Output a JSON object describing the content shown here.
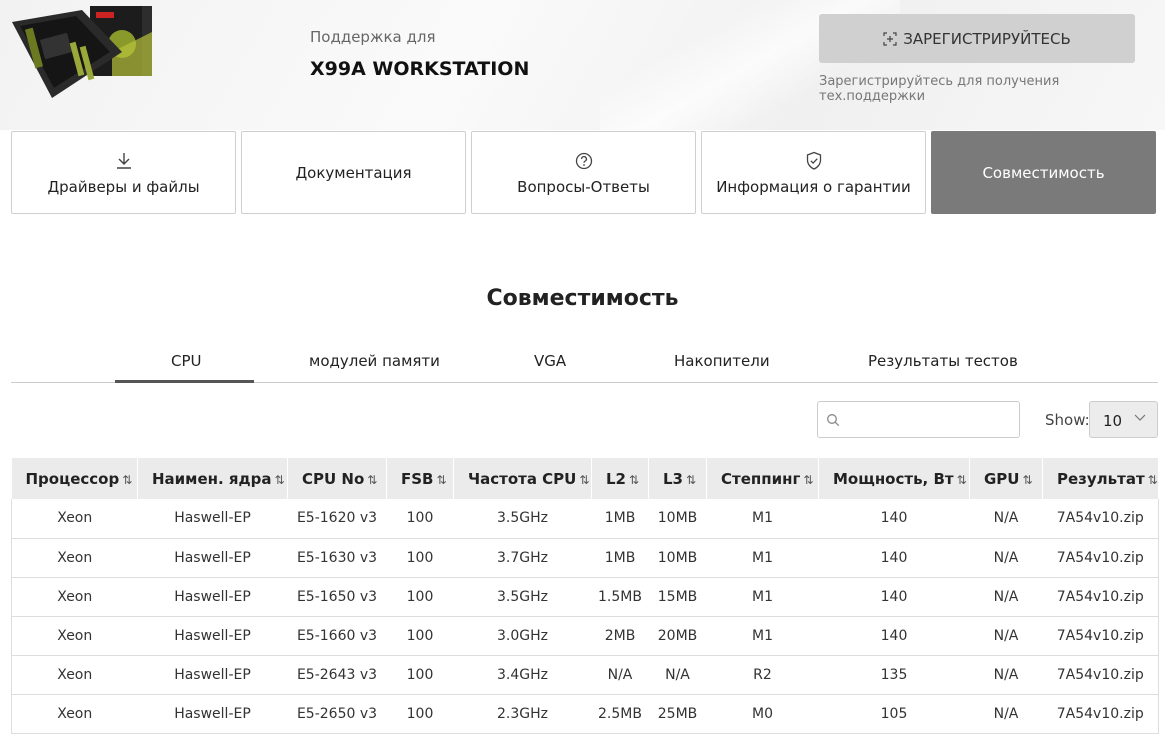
{
  "header": {
    "support_for": "Поддержка для",
    "model": "X99A WORKSTATION",
    "register_button": "ЗАРЕГИСТРИРУЙТЕСЬ",
    "register_note": "Зарегистрируйтесь для получения тех.поддержки"
  },
  "nav_tabs": [
    {
      "label": "Драйверы и файлы",
      "icon": "download-icon"
    },
    {
      "label": "Документация",
      "icon": ""
    },
    {
      "label": "Вопросы-Ответы",
      "icon": "question-icon"
    },
    {
      "label": "Информация о гарантии",
      "icon": "shield-check-icon"
    },
    {
      "label": "Совместимость",
      "icon": "",
      "active": true
    }
  ],
  "section": {
    "title": "Совместимость",
    "subtabs": [
      "CPU",
      "модулей памяти",
      "VGA",
      "Накопители",
      "Результаты тестов"
    ],
    "active_subtab": "CPU"
  },
  "controls": {
    "search_value": "",
    "show_label": "Show:",
    "show_value": "10"
  },
  "table": {
    "columns": [
      "Процессор",
      "Наимен. ядра",
      "CPU No",
      "FSB",
      "Частота CPU",
      "L2",
      "L3",
      "Степпинг",
      "Мощность, Вт",
      "GPU",
      "Результат"
    ],
    "sort_glyph": "⇅",
    "rows": [
      [
        "Xeon",
        "Haswell-EP",
        "E5-1620 v3",
        "100",
        "3.5GHz",
        "1MB",
        "10MB",
        "M1",
        "140",
        "N/A",
        "7A54v10.zip"
      ],
      [
        "Xeon",
        "Haswell-EP",
        "E5-1630 v3",
        "100",
        "3.7GHz",
        "1MB",
        "10MB",
        "M1",
        "140",
        "N/A",
        "7A54v10.zip"
      ],
      [
        "Xeon",
        "Haswell-EP",
        "E5-1650 v3",
        "100",
        "3.5GHz",
        "1.5MB",
        "15MB",
        "M1",
        "140",
        "N/A",
        "7A54v10.zip"
      ],
      [
        "Xeon",
        "Haswell-EP",
        "E5-1660 v3",
        "100",
        "3.0GHz",
        "2MB",
        "20MB",
        "M1",
        "140",
        "N/A",
        "7A54v10.zip"
      ],
      [
        "Xeon",
        "Haswell-EP",
        "E5-2643 v3",
        "100",
        "3.4GHz",
        "N/A",
        "N/A",
        "R2",
        "135",
        "N/A",
        "7A54v10.zip"
      ],
      [
        "Xeon",
        "Haswell-EP",
        "E5-2650 v3",
        "100",
        "2.3GHz",
        "2.5MB",
        "25MB",
        "M0",
        "105",
        "N/A",
        "7A54v10.zip"
      ]
    ]
  },
  "colors": {
    "active_tab_bg": "#7a7a7a",
    "register_bg": "#d0d0d0",
    "table_header_bg": "#ebebeb"
  }
}
